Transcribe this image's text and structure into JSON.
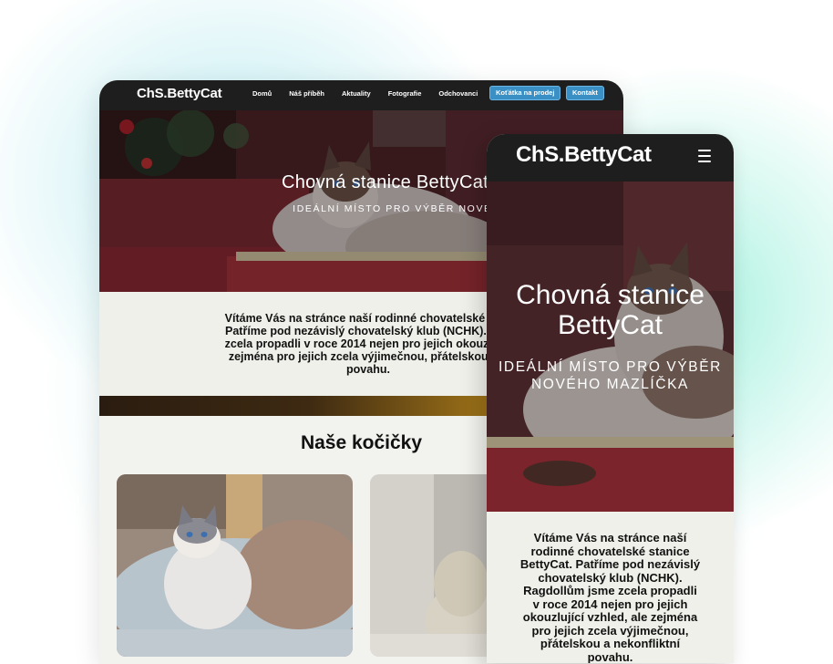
{
  "brand": "ChS.BettyCat",
  "desktop": {
    "nav": {
      "items": [
        "Domů",
        "Náš příběh",
        "Aktuality",
        "Fotografie",
        "Odchovanci"
      ],
      "buttons": [
        "Koťátka na prodej",
        "Kontakt"
      ]
    },
    "hero": {
      "title": "Chovná stanice BettyCat",
      "subtitle": "IDEÁLNÍ MÍSTO PRO VÝBĚR NOVÉHO MAZLÍČK"
    },
    "welcome": {
      "lines": [
        "Vítáme Vás na stránce naší rodinné chovatelské stan",
        "Patříme pod nezávislý chovatelský klub (NCHK). Rag",
        "zcela propadli v roce 2014 nejen pro jejich okouzlujíc",
        "zejména pro jejich zcela výjimečnou, přátelskou a n",
        "povahu."
      ]
    },
    "section_title": "Naše kočičky"
  },
  "mobile": {
    "hero": {
      "title_lines": [
        "Chovná stanice",
        "BettyCat"
      ],
      "subtitle_lines": [
        "IDEÁLNÍ MÍSTO PRO VÝBĚR",
        "NOVÉHO MAZLÍČKA"
      ]
    },
    "welcome": {
      "lines": [
        "Vítáme Vás na stránce naší",
        "rodinné chovatelské stanice",
        "BettyCat. Patříme pod nezávislý",
        "chovatelský klub (NCHK).",
        "Ragdollům jsme zcela propadli",
        "v roce 2014 nejen pro jejich",
        "okouzlující vzhled, ale zejména",
        "pro jejich zcela výjimečnou,",
        "přátelskou a nekonfliktní",
        "povahu."
      ]
    }
  },
  "colors": {
    "nav_bg": "#1e1e1e",
    "accent_button": "#3a8fc4",
    "section_bg": "#f0f0ea"
  }
}
